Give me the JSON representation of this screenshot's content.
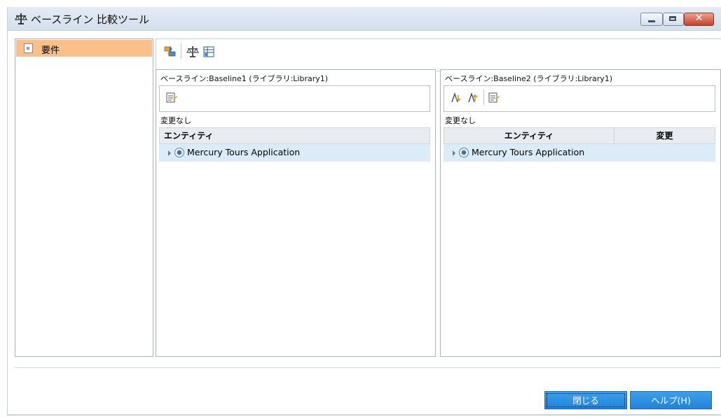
{
  "window": {
    "title": "ベースライン 比較ツール",
    "title_icon": "scale-icon",
    "controls": [
      "minimize-icon",
      "maximize-icon",
      "close-icon"
    ]
  },
  "sidebar": {
    "items": [
      {
        "label": "要件",
        "icon": "requirement-icon",
        "selected": true
      }
    ]
  },
  "main_toolbar": {
    "icons": [
      "compare-icon",
      "scale-icon",
      "grid-settings-icon"
    ]
  },
  "baseline_left": {
    "title": "ベースライン:Baseline1 (ライブラリ:Library1)",
    "toolbar_icons": [
      "details-icon"
    ],
    "status": "変更なし",
    "columns": [
      "エンティティ"
    ],
    "rows": [
      {
        "label": "Mercury Tours Application"
      }
    ]
  },
  "baseline_right": {
    "title": "ベースライン:Baseline2 (ライブラリ:Library1)",
    "toolbar_icons": [
      "prev-change-icon",
      "next-change-icon",
      "details-icon"
    ],
    "status": "変更なし",
    "columns": [
      "エンティティ",
      "変更"
    ],
    "rows": [
      {
        "label": "Mercury Tours Application",
        "change": ""
      }
    ]
  },
  "footer": {
    "close_label": "閉じる",
    "help_label": "ヘルプ(H)"
  },
  "colors": {
    "selected_sidebar": "#fbbf89",
    "row_highlight": "#dcebf8",
    "button_blue": "#2a8fe0"
  }
}
